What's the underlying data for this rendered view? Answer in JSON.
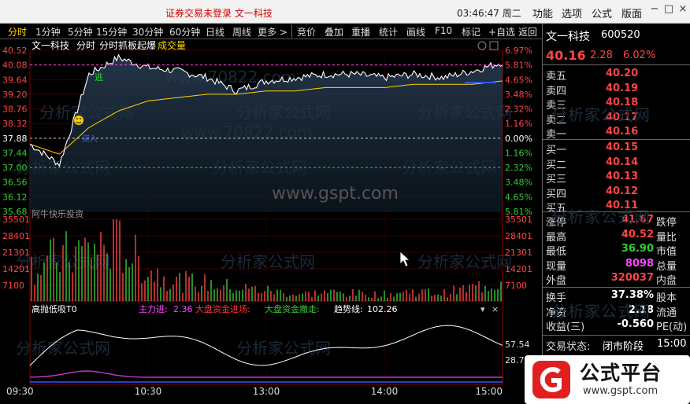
{
  "window": {
    "title": "证券交易未登录  文一科技",
    "clock": "03:46:47 周二",
    "menus": [
      "功能",
      "选项",
      "公式",
      "版面"
    ],
    "controls": {
      "minimize": "−",
      "maximize": "□",
      "close": "×"
    }
  },
  "toolbar": {
    "period_tabs": [
      "分时",
      "1分钟",
      "5分钟",
      "15分钟",
      "30分钟",
      "60分钟",
      "日线",
      "周线",
      "更多 >"
    ],
    "active_tab": "分时",
    "functions": [
      "竞价",
      "叠加",
      "重播",
      "统计",
      "画线",
      "F10",
      "标记",
      "+自选",
      "返回"
    ]
  },
  "chart": {
    "header": {
      "stock": "文一科技",
      "mode": "分时",
      "formula": "分时抓板起爆",
      "volume_label": "成交量"
    },
    "price_ticks": [
      "40.52",
      "40.08",
      "39.64",
      "39.20",
      "38.76",
      "38.32",
      "37.88",
      "37.44",
      "37.00",
      "36.56",
      "36.12",
      "35.68"
    ],
    "pct_ticks": [
      "6.97%",
      "5.81%",
      "4.65%",
      "3.48%",
      "2.32%",
      "1.16%",
      "0.00%",
      "1.16%",
      "2.32%",
      "3.48%",
      "4.65%",
      "5.81%"
    ],
    "volume_ticks": [
      "35501",
      "28401",
      "21301",
      "14201",
      "7100"
    ],
    "volume_panel_label": "阿牛快乐投资",
    "indicator_header": {
      "name": "高抛低吸T0",
      "zhuli_label": "主力进:",
      "zhuli_value": "2.36",
      "dapan_in": "大盘资金进场:",
      "dapan_out": "大盘资金撤走:",
      "trend_label": "趋势线:",
      "trend_value": "102.26"
    },
    "indicator_ticks": [
      "57.54",
      "28.77"
    ],
    "time_labels": [
      "09:30",
      "10:30",
      "13:00",
      "14:00",
      "15:00"
    ],
    "markers": {
      "escape": "逃",
      "buy": "买入"
    },
    "watermark_site": "www.gspt.com",
    "watermark_cn": "分析家公式网",
    "watermark_url": "www.70822.com",
    "colors": {
      "price_line": "#ffffff",
      "avg_line": "#ffd700",
      "up": "#ff4444",
      "down": "#33cc33",
      "grid": "#8b0000"
    }
  },
  "chart_data": {
    "type": "line",
    "title": "文一科技 分时",
    "x": [
      "09:30",
      "09:45",
      "10:00",
      "10:15",
      "10:30",
      "10:45",
      "11:00",
      "11:15",
      "11:30",
      "13:15",
      "13:30",
      "13:45",
      "14:00",
      "14:15",
      "14:30",
      "14:45",
      "15:00"
    ],
    "series": [
      {
        "name": "价格",
        "values": [
          37.7,
          37.1,
          39.8,
          40.3,
          40.0,
          39.9,
          39.7,
          39.3,
          39.6,
          39.7,
          39.8,
          39.8,
          39.7,
          39.8,
          39.7,
          39.9,
          40.16
        ]
      },
      {
        "name": "均价",
        "values": [
          37.7,
          37.4,
          38.2,
          38.7,
          39.0,
          39.1,
          39.2,
          39.2,
          39.3,
          39.3,
          39.4,
          39.4,
          39.4,
          39.5,
          39.5,
          39.5,
          39.6
        ]
      }
    ],
    "volume": [
      16000,
      20000,
      24000,
      26000,
      14000,
      9000,
      8000,
      6000,
      5000,
      3000,
      4000,
      3500,
      3000,
      4500,
      3500,
      6000,
      9000
    ],
    "ylim": [
      35.68,
      40.52
    ],
    "xlabel": "",
    "ylabel": ""
  },
  "quote": {
    "name": "文一科技",
    "code": "600520",
    "price": "40.16",
    "change": "2.28",
    "change_pct": "6.02%",
    "asks": [
      {
        "label": "卖五",
        "price": "40.20"
      },
      {
        "label": "卖四",
        "price": "40.19"
      },
      {
        "label": "卖三",
        "price": "40.18"
      },
      {
        "label": "卖二",
        "price": "40.17"
      },
      {
        "label": "卖一",
        "price": "40.16"
      }
    ],
    "bids": [
      {
        "label": "买一",
        "price": "40.15"
      },
      {
        "label": "买二",
        "price": "40.14"
      },
      {
        "label": "买三",
        "price": "40.13"
      },
      {
        "label": "买四",
        "price": "40.12"
      },
      {
        "label": "买五",
        "price": "40.11"
      }
    ],
    "stats": [
      {
        "l": "涨停",
        "v": "41.67",
        "r": "跌停",
        "vc": "#ff4444"
      },
      {
        "l": "最高",
        "v": "40.52",
        "r": "量比",
        "vc": "#ff4444"
      },
      {
        "l": "最低",
        "v": "36.90",
        "r": "市值",
        "vc": "#33cc33"
      },
      {
        "l": "现量",
        "v": "8098",
        "r": "总量",
        "vc": "#ff44ff"
      },
      {
        "l": "外盘",
        "v": "320037",
        "r": "内盘",
        "vc": "#ff4444"
      }
    ],
    "stats2": [
      {
        "l": "换手",
        "v": "37.38%",
        "r": "股本"
      },
      {
        "l": "净资",
        "v": "2.18",
        "r": "流通"
      },
      {
        "l": "收益(三)",
        "v": "-0.560",
        "r": "PE(动)"
      }
    ],
    "trade_status_label": "交易状态:",
    "trade_status": "闭市阶段",
    "trade_time": "15:00"
  },
  "badge": {
    "brand": "公式平台",
    "url": "www.gspt.com"
  }
}
